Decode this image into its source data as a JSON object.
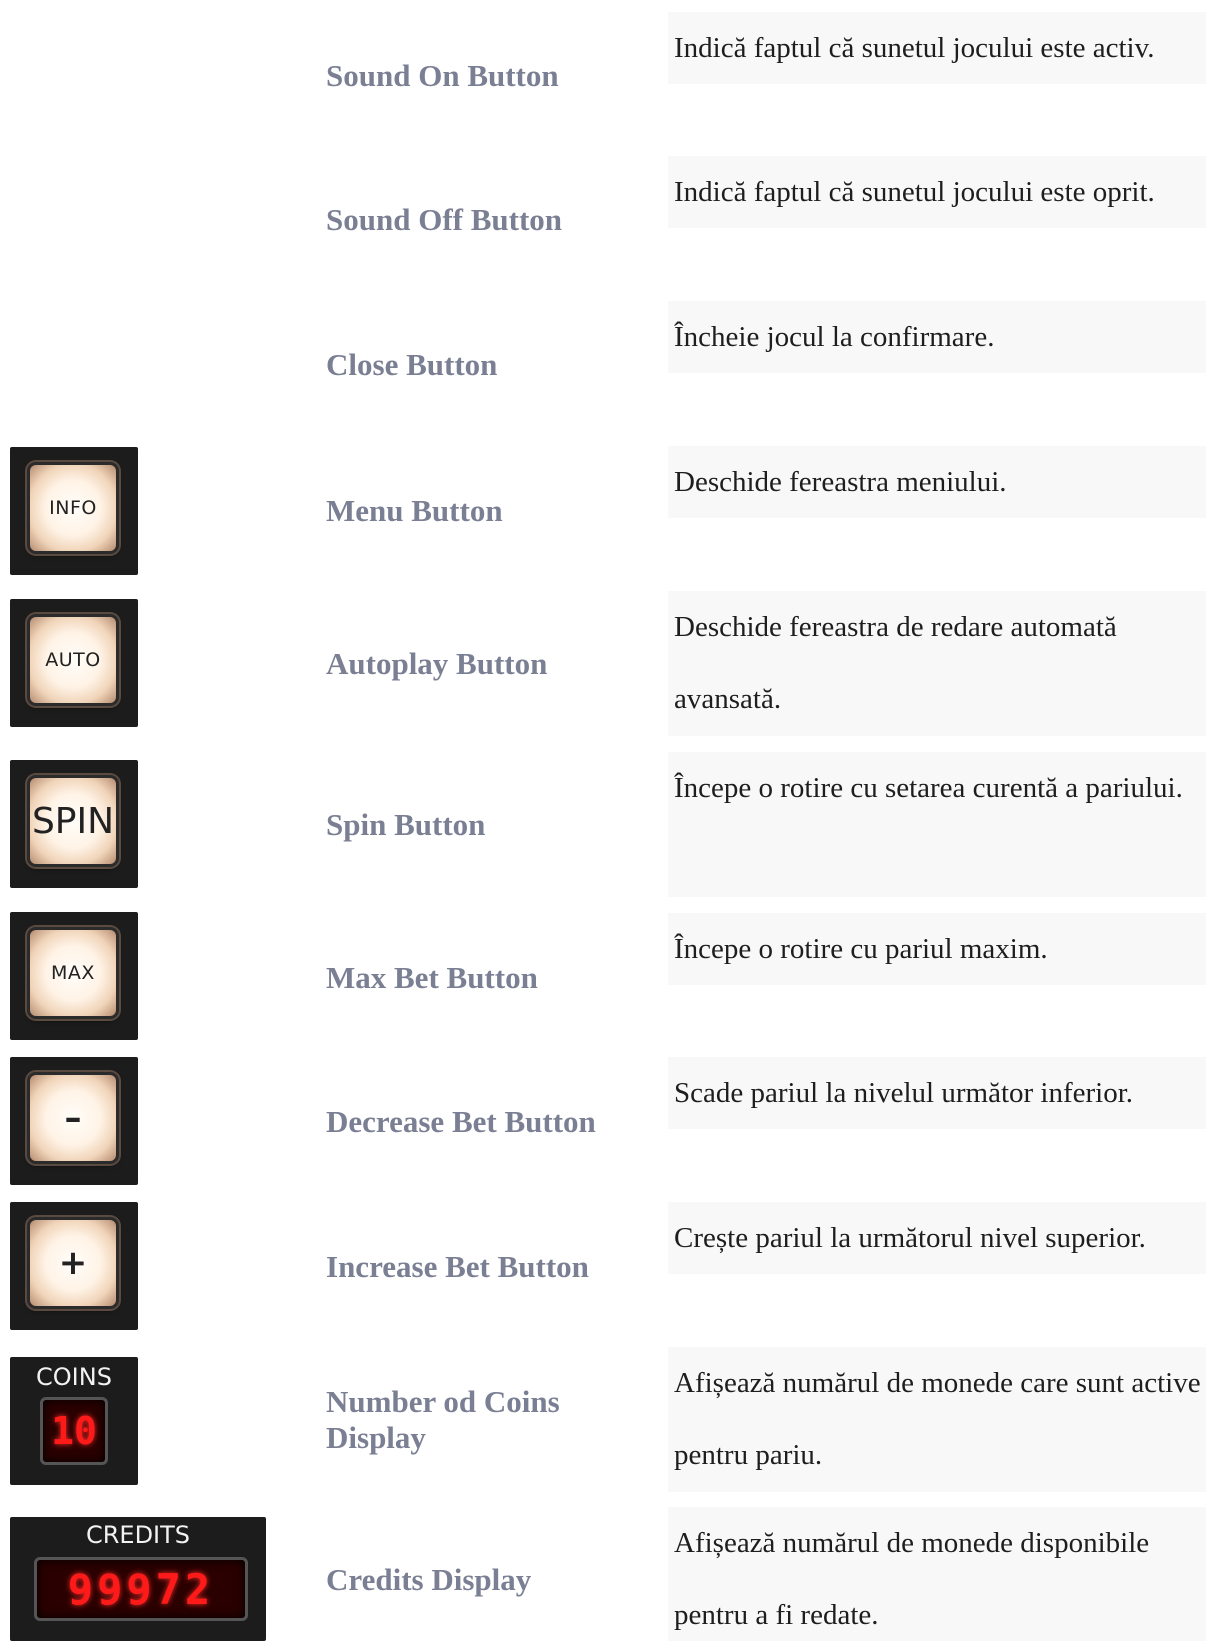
{
  "rows": [
    {
      "name": "Sound On Button",
      "desc": "Indică faptul că sunetul jocului este activ."
    },
    {
      "name": "Sound Off Button",
      "desc": "Indică faptul că sunetul jocului este oprit."
    },
    {
      "name": "Close Button",
      "desc": "Încheie jocul la confirmare."
    },
    {
      "name": "Menu Button",
      "desc": "Deschide fereastra meniului.",
      "icon_label": "INFO"
    },
    {
      "name": "Autoplay Button",
      "desc": "Deschide fereastra de redare automată avansată.",
      "icon_label": "AUTO"
    },
    {
      "name": "Spin Button",
      "desc": "Începe o rotire cu setarea curentă a pariului.",
      "icon_label": "SPIN"
    },
    {
      "name": "Max Bet Button",
      "desc": "Începe o rotire cu pariul maxim.",
      "icon_label": "MAX"
    },
    {
      "name": "Decrease Bet Button",
      "desc": "Scade pariul la nivelul următor inferior.",
      "icon_label": "–"
    },
    {
      "name": "Increase Bet Button",
      "desc": "Crește pariul la următorul nivel superior.",
      "icon_label": "+"
    },
    {
      "name": "Number od Coins Display",
      "desc": "Afișează numărul de monede care sunt active pentru pariu.",
      "icon_label": "COINS",
      "icon_value": "10"
    },
    {
      "name": "Credits Display",
      "desc": "Afișează numărul de monede disponibile pentru a fi redate.",
      "icon_label": "CREDITS",
      "icon_value": "99972"
    }
  ],
  "colors": {
    "name_text": "#7a7f93",
    "desc_bg": "#f8f8f8",
    "lcd_digits": "#ff1a1a"
  }
}
